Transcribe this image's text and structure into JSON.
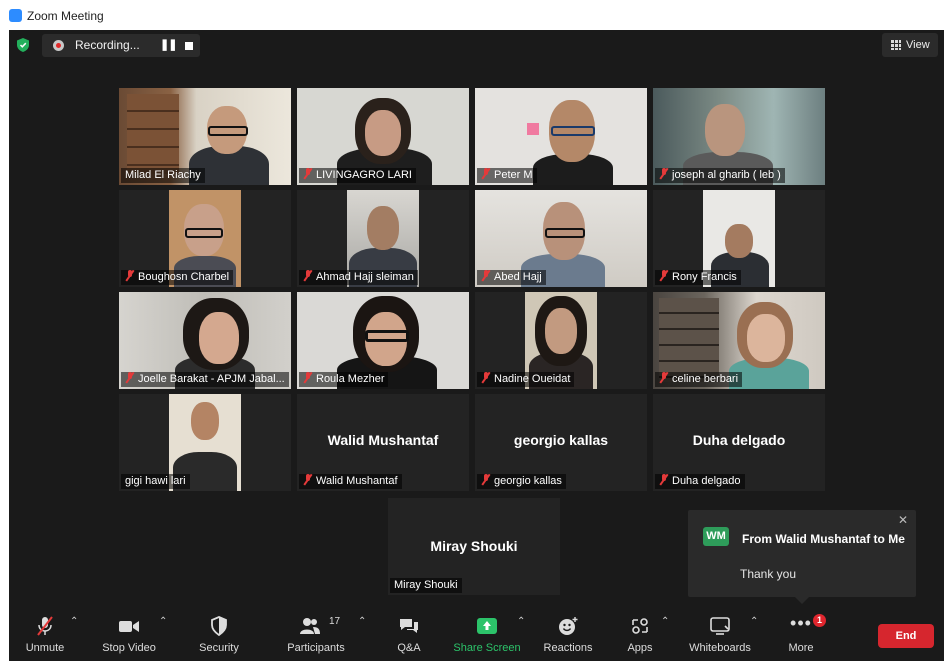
{
  "window": {
    "title": "Zoom Meeting"
  },
  "recording": {
    "label": "Recording...",
    "pause_icon": "pause-icon",
    "stop_icon": "stop-icon"
  },
  "view": {
    "label": "View"
  },
  "participants_grid": [
    {
      "name": "Milad El Riachy",
      "muted": false,
      "video": true,
      "speaking": true
    },
    {
      "name": "LIVINGAGRO LARI",
      "muted": true,
      "video": true
    },
    {
      "name": "Peter M",
      "muted": true,
      "video": true
    },
    {
      "name": "joseph al gharib ( leb )",
      "muted": true,
      "video": true
    },
    {
      "name": "Boughosn Charbel",
      "muted": true,
      "video": true
    },
    {
      "name": "Ahmad Hajj sleiman",
      "muted": true,
      "video": true
    },
    {
      "name": "Abed Hajj",
      "muted": true,
      "video": true
    },
    {
      "name": "Rony Francis",
      "muted": true,
      "video": true
    },
    {
      "name": "Joelle Barakat - APJM Jabal...",
      "muted": true,
      "video": true
    },
    {
      "name": "Roula Mezher",
      "muted": true,
      "video": true
    },
    {
      "name": "Nadine Oueidat",
      "muted": true,
      "video": true
    },
    {
      "name": "celine berbari",
      "muted": true,
      "video": true
    },
    {
      "name": "gigi hawi lari",
      "muted": false,
      "video": true
    },
    {
      "name": "Walid Mushantaf",
      "muted": true,
      "video": false,
      "display_name": "Walid Mushantaf"
    },
    {
      "name": "georgio kallas",
      "muted": true,
      "video": false,
      "display_name": "georgio kallas"
    },
    {
      "name": "Duha delgado",
      "muted": true,
      "video": false,
      "display_name": "Duha delgado"
    },
    {
      "name": "Miray Shouki",
      "muted": false,
      "video": false,
      "display_name": "Miray Shouki"
    }
  ],
  "chat_notification": {
    "avatar_initials": "WM",
    "avatar_color": "#2e9c5a",
    "title": "From Walid Mushantaf to Me",
    "message": "Thank you",
    "close_icon": "close-icon"
  },
  "toolbar": {
    "unmute": "Unmute",
    "stop_video": "Stop Video",
    "security": "Security",
    "participants": "Participants",
    "participants_count": "17",
    "qa": "Q&A",
    "share_screen": "Share Screen",
    "reactions": "Reactions",
    "apps": "Apps",
    "whiteboards": "Whiteboards",
    "more": "More",
    "more_badge": "1",
    "end": "End"
  },
  "colors": {
    "end_button": "#d6262e",
    "share_screen": "#2cc36a",
    "speaking_outline": "#c8e36a",
    "muted_mic": "#e43a3a"
  }
}
